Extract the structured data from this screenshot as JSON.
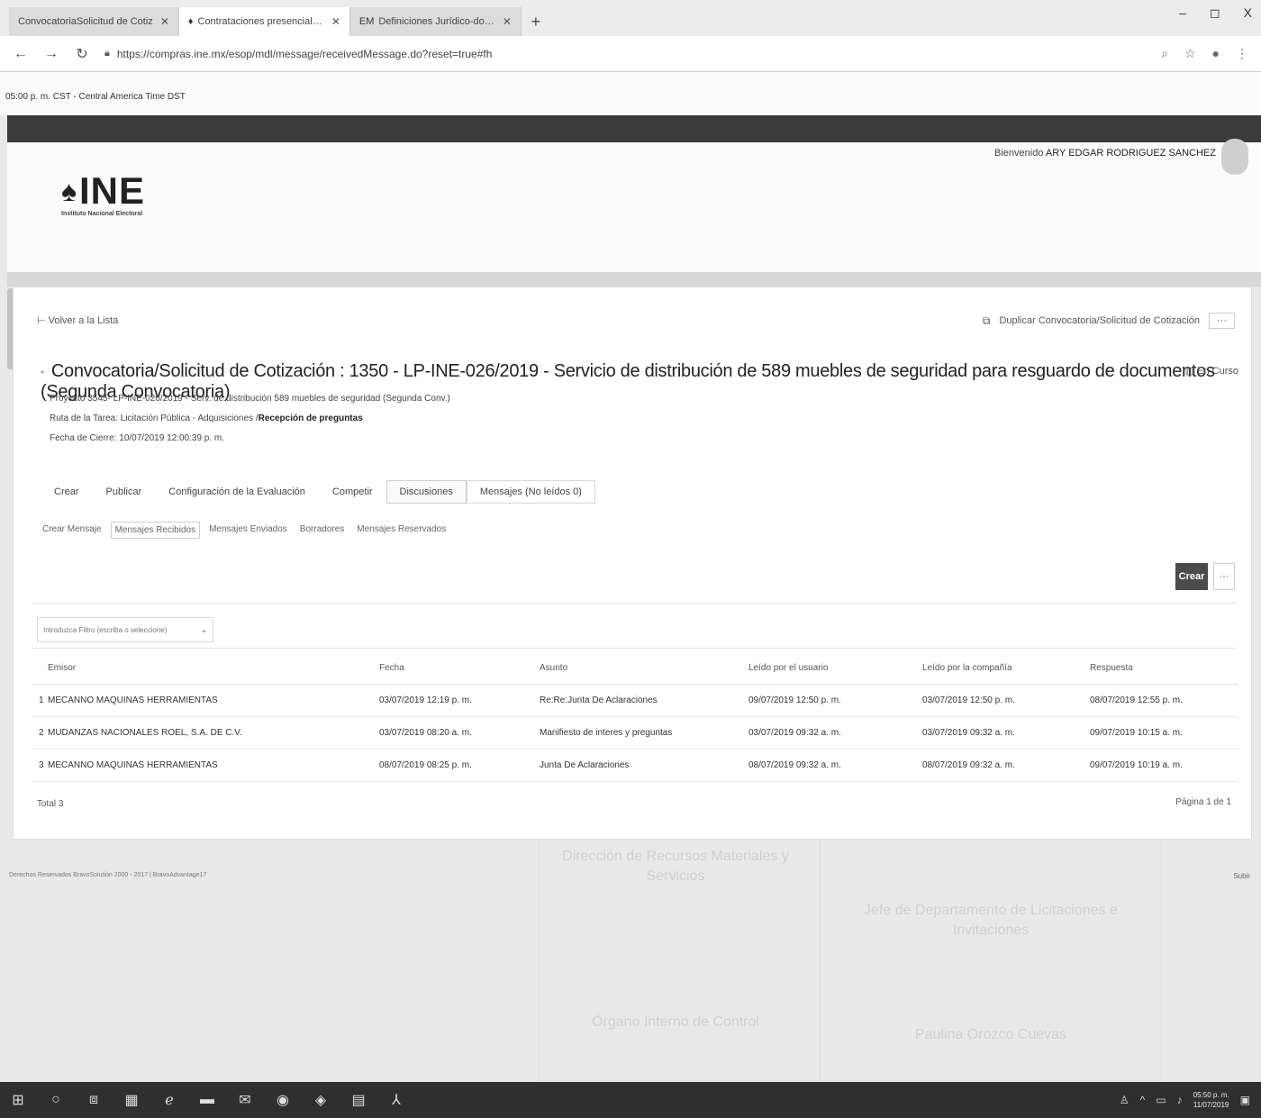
{
  "browser": {
    "tabs": [
      {
        "label": "ConvocatoriaSolicitud de Cotiz",
        "favicon": ""
      },
      {
        "label": "Contrataciones presenciales - Ins",
        "favicon": "♦"
      },
      {
        "label": "Definiciones Jurídico-doctrinales",
        "favicon": "EM"
      }
    ],
    "new_tab": "+",
    "url": "https://compras.ine.mx/esop/mdl/message/receivedMessage.do?reset=true#fh",
    "minimize": "–",
    "maximize": "◻",
    "close": "X"
  },
  "timezone": "05:00 p. m. CST - Central America Time DST",
  "header": {
    "welcome_prefix": "Bienvenido",
    "user_name": "ARY EDGAR RODRIGUEZ SANCHEZ",
    "logo_text": "INE",
    "logo_subtitle": "Instituto Nacional Electoral"
  },
  "card": {
    "back_link": "Volver a la Lista",
    "duplicate_link": "Duplicar Convocatoria/Solicitud de Cotización",
    "more": "···",
    "title": "Convocatoria/Solicitud de Cotización : 1350 - LP-INE-026/2019 - Servicio de distribución de 589 muebles de seguridad para resguardo de documentos (Segunda Convocatoria)",
    "status": "En Curso",
    "project": "Proyecto 3545- LP-INE-026/2019 - Serv. de distribución 589 muebles de seguridad (Segunda Conv.)",
    "route_prefix": "Ruta de la Tarea: Licitación Pública - Adquisiciones /",
    "route_current": "Recepción de preguntas",
    "close_date": "Fecha de Cierre: 10/07/2019 12:00:39 p. m.",
    "tabs": [
      "Crear",
      "Publicar",
      "Configuración de la Evaluación",
      "Competir",
      "Discusiones",
      "Mensajes (No leídos 0)"
    ],
    "subtabs": [
      "Crear Mensaje",
      "Mensajes Recibidos",
      "Mensajes Enviados",
      "Borradores",
      "Mensajes Reservados"
    ],
    "create_button": "Crear",
    "filter_placeholder": "Introduzca Filtro (escriba o seleccione)"
  },
  "table": {
    "headers": [
      "",
      "Emisor",
      "Fecha",
      "Asunto",
      "Leído por el usuario",
      "Leído por la compañía",
      "Respuesta"
    ],
    "rows": [
      {
        "n": "1",
        "emisor": "MECANNO MAQUINAS HERRAMIENTAS",
        "fecha": "03/07/2019 12:19 p. m.",
        "asunto": "Re:Re:Junta De Aclaraciones",
        "leido_u": "09/07/2019 12:50 p. m.",
        "leido_c": "03/07/2019 12:50 p. m.",
        "respuesta": "08/07/2019 12:55 p. m."
      },
      {
        "n": "2",
        "emisor": "MUDANZAS NACIONALES ROEL, S.A. DE C.V.",
        "fecha": "03/07/2019 08:20 a. m.",
        "asunto": "Manifiesto de interes y preguntas",
        "leido_u": "03/07/2019 09:32 a. m.",
        "leido_c": "03/07/2019 09:32 a. m.",
        "respuesta": "09/07/2019 10:15 a. m."
      },
      {
        "n": "3",
        "emisor": "MECANNO MAQUINAS HERRAMIENTAS",
        "fecha": "08/07/2019 08:25 p. m.",
        "asunto": "Junta De Aclaraciones",
        "leido_u": "08/07/2019 09:32 a. m.",
        "leido_c": "08/07/2019 09:32 a. m.",
        "respuesta": "09/07/2019 10:19 a. m."
      }
    ],
    "total": "Total 3",
    "pager": "Página 1 de 1"
  },
  "footer": {
    "left": "Derechos Reservados BravoSolution 2000 - 2017 | BravoAdvantage17",
    "right": "Subir"
  },
  "background_text": [
    "Dirección de Recursos Materiales y Servicios",
    "Jefe de Departamento de Licitaciones e Invitaciones",
    "Órgano Interno de Control",
    "Paulina Orozco Cuevas"
  ],
  "taskbar": {
    "time": "05:50 p. m.",
    "date": "11/07/2019"
  }
}
